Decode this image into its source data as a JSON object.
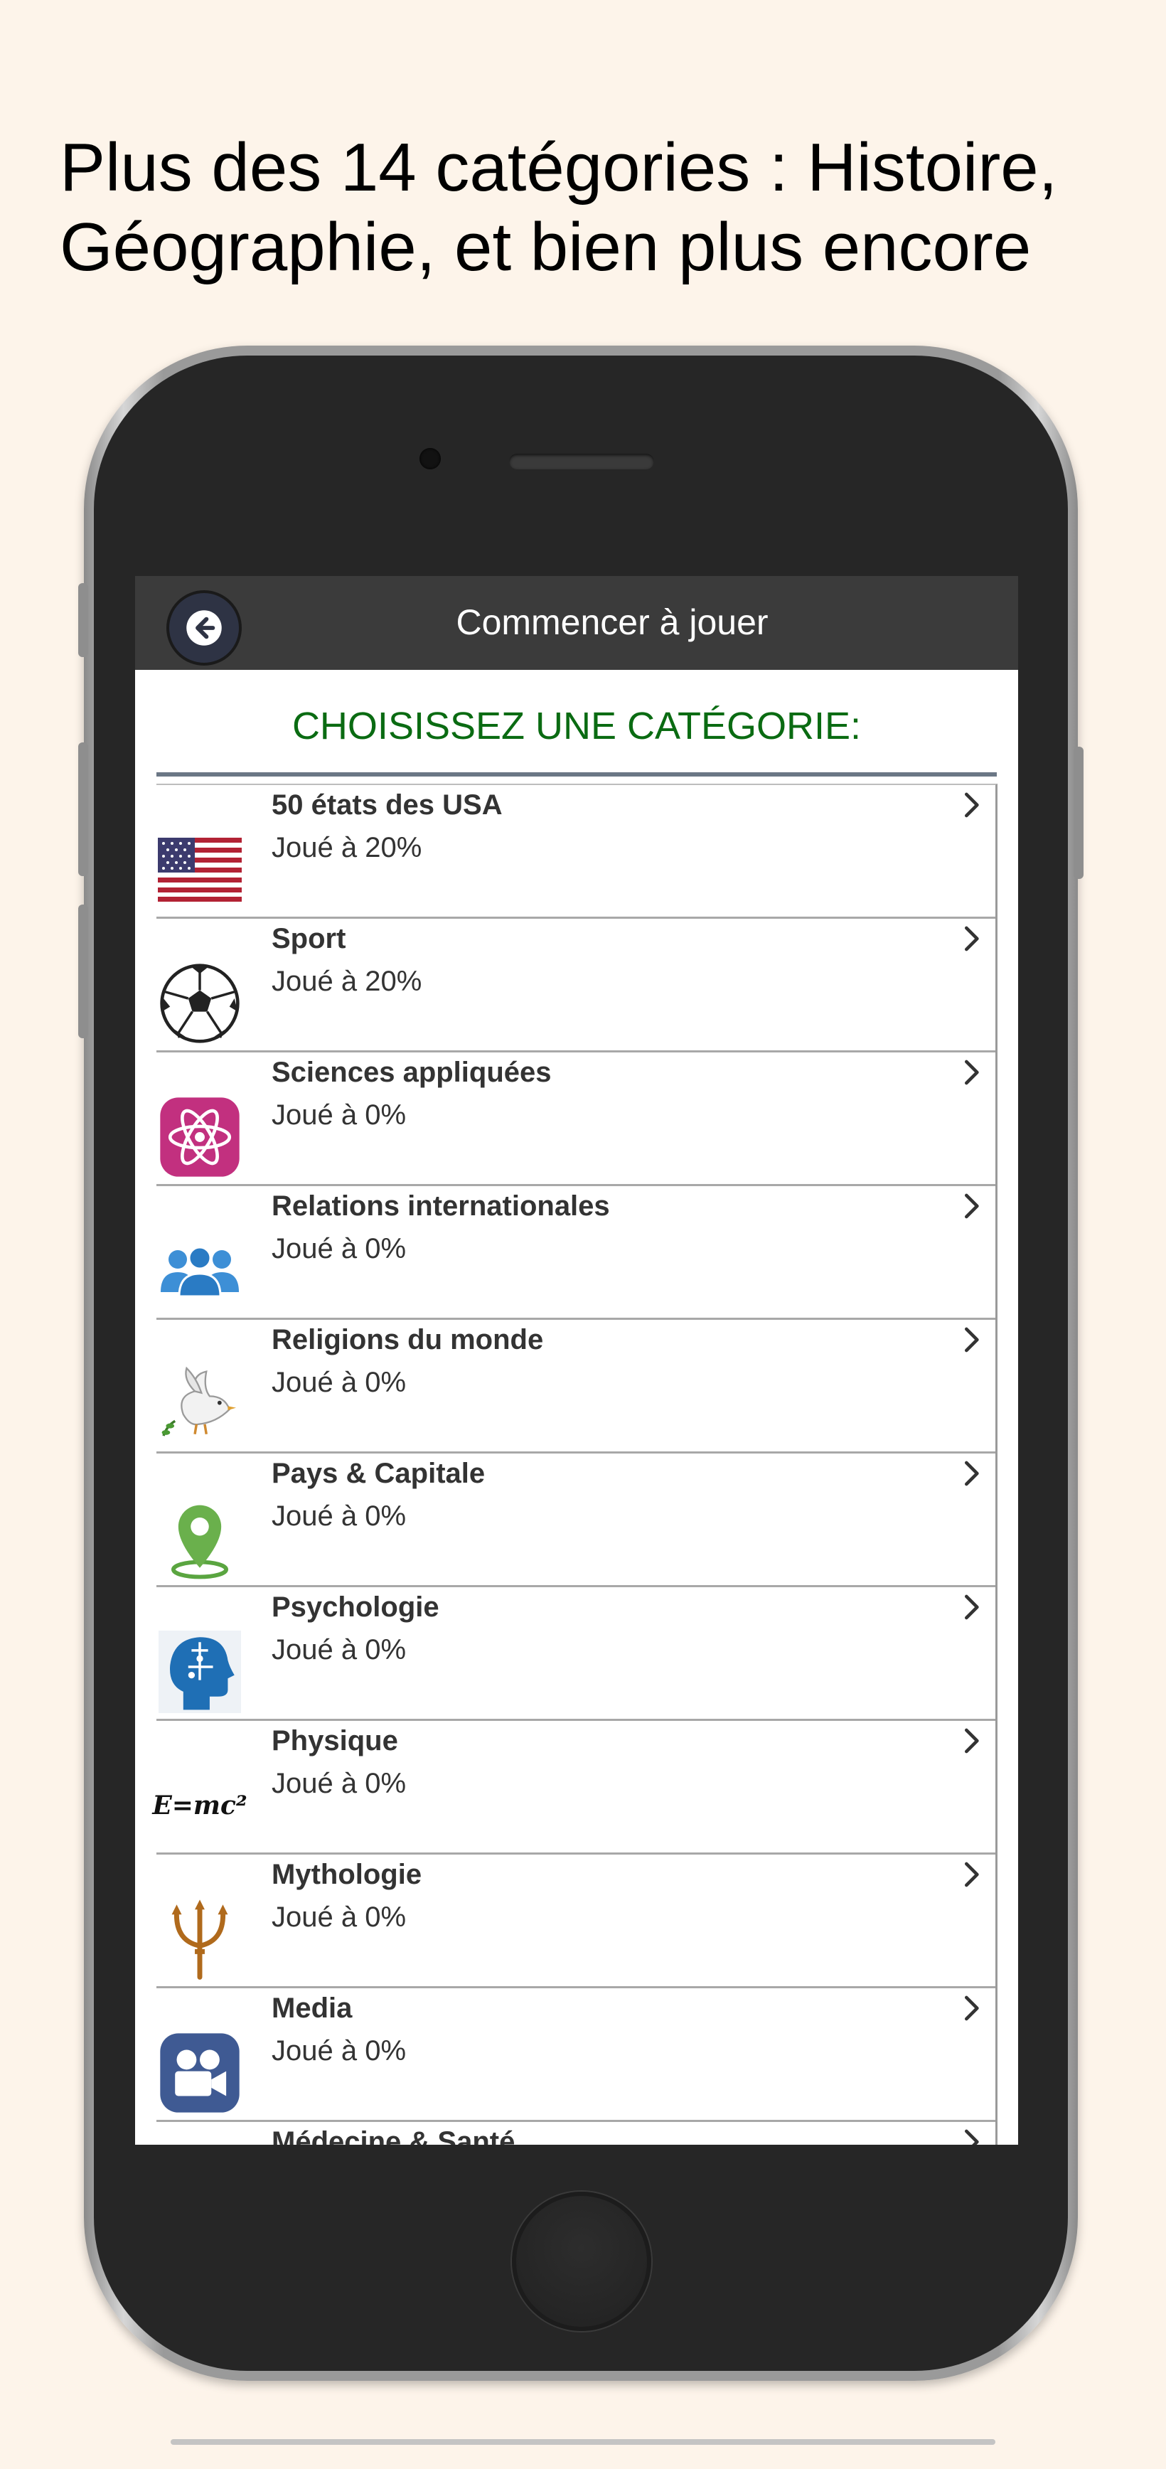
{
  "headline": {
    "line1": "Plus des 14 catégories : Histoire,",
    "line2": "Géographie, et bien plus encore"
  },
  "navbar": {
    "title": "Commencer à jouer",
    "back_icon": "arrow-left-icon"
  },
  "section_title": "CHOISISSEZ UNE CATÉGORIE:",
  "categories": [
    {
      "name": "50 états des USA",
      "progress": "Joué à 20%",
      "icon": "us-flag-icon"
    },
    {
      "name": "Sport",
      "progress": "Joué à 20%",
      "icon": "soccer-ball-icon"
    },
    {
      "name": "Sciences appliquées",
      "progress": "Joué à 0%",
      "icon": "atom-icon"
    },
    {
      "name": "Relations internationales",
      "progress": "Joué à 0%",
      "icon": "people-icon"
    },
    {
      "name": "Religions du monde",
      "progress": "Joué à 0%",
      "icon": "dove-icon"
    },
    {
      "name": "Pays & Capitale",
      "progress": "Joué à 0%",
      "icon": "map-pin-icon"
    },
    {
      "name": "Psychologie",
      "progress": "Joué à 0%",
      "icon": "puzzle-head-icon"
    },
    {
      "name": "Physique",
      "progress": "Joué à 0%",
      "icon": "emc2-icon",
      "icon_text": "E=mc²"
    },
    {
      "name": "Mythologie",
      "progress": "Joué à 0%",
      "icon": "trident-icon"
    },
    {
      "name": "Media",
      "progress": "Joué à 0%",
      "icon": "video-camera-icon"
    },
    {
      "name": "Médecine & Santé",
      "progress": "",
      "icon": ""
    }
  ],
  "colors": {
    "background": "#fdf4ea",
    "navbar": "#3b3b3b",
    "section_title": "#0a6b12",
    "rule": "#6b7785"
  }
}
